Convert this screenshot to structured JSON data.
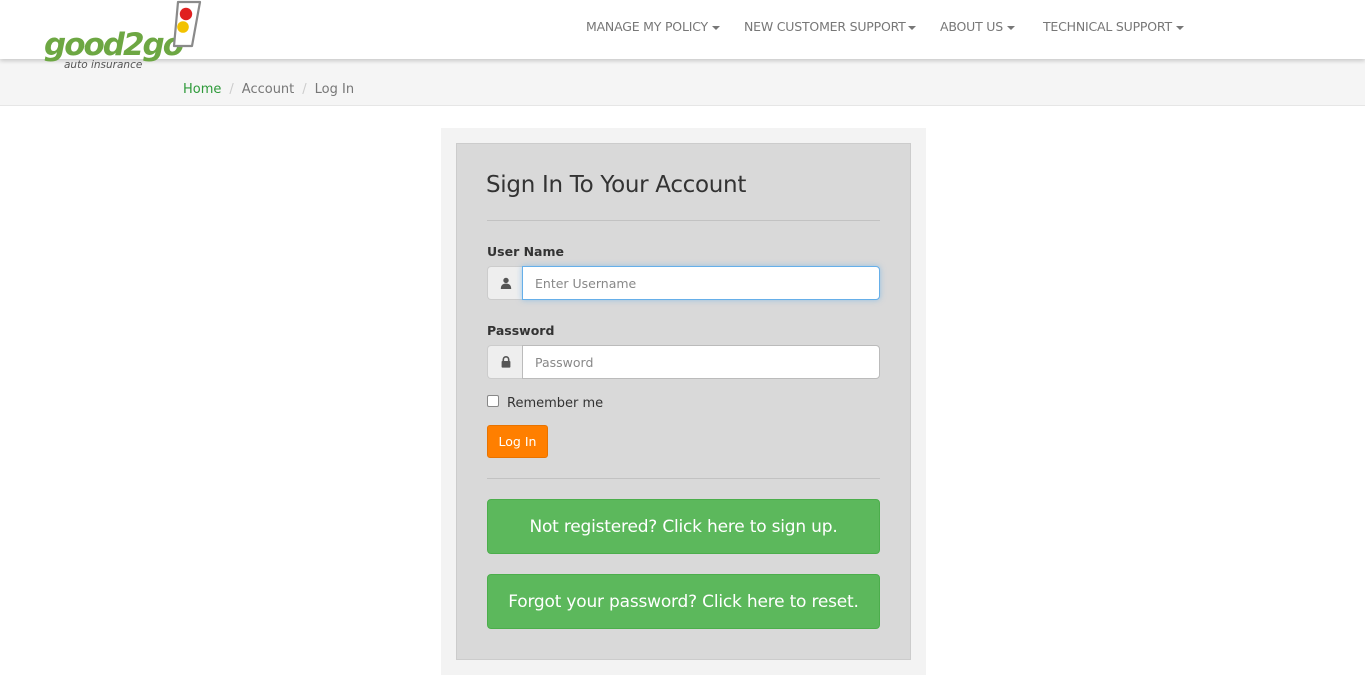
{
  "brand": {
    "logo_word": "good2go",
    "logo_sub": "auto insurance",
    "colors": {
      "green": "#6da743",
      "red": "#e02020",
      "yellow": "#f2c200",
      "gray": "#888888"
    }
  },
  "nav": {
    "items": [
      {
        "label": "MANAGE MY POLICY"
      },
      {
        "label": "NEW CUSTOMER SUPPORT"
      },
      {
        "label": "ABOUT US"
      },
      {
        "label": "TECHNICAL SUPPORT"
      }
    ]
  },
  "breadcrumb": {
    "items": [
      {
        "label": "Home",
        "link": true
      },
      {
        "label": "Account",
        "link": false
      },
      {
        "label": "Log In",
        "link": false
      }
    ],
    "separator": "/"
  },
  "login": {
    "title": "Sign In To Your Account",
    "username_label": "User Name",
    "username_placeholder": "Enter Username",
    "username_value": "",
    "password_label": "Password",
    "password_placeholder": "Password",
    "password_value": "",
    "remember_label": "Remember me",
    "remember_checked": false,
    "login_button": "Log In",
    "signup_button": "Not registered? Click here to sign up.",
    "reset_button": "Forgot your password? Click here to reset."
  },
  "icons": {
    "user": "user-icon",
    "lock": "lock-icon",
    "caret": "caret-down-icon"
  },
  "accent_colors": {
    "login_button": "#ff7f00",
    "green_buttons": "#5cb85c",
    "breadcrumb_link": "#2e9a3a"
  }
}
